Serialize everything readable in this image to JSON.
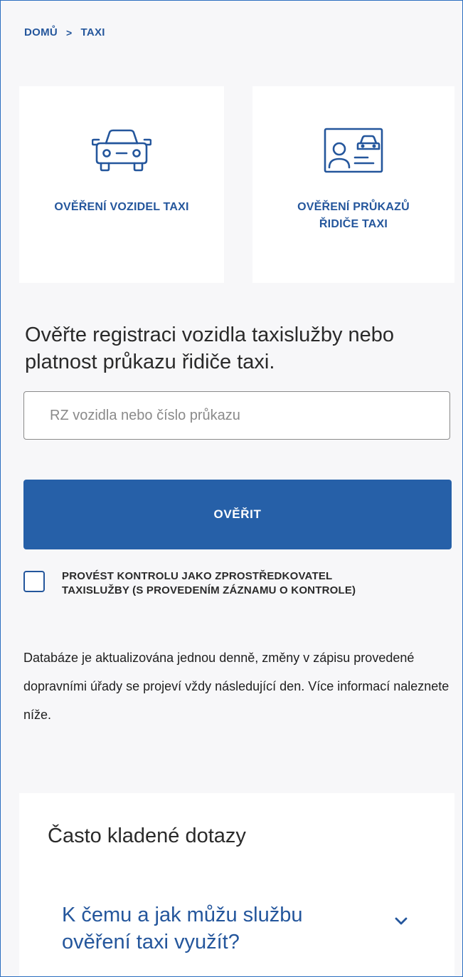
{
  "breadcrumb": {
    "home": "DOMŮ",
    "separator": ">",
    "current": "TAXI"
  },
  "cards": {
    "vehicles": {
      "label": "OVĚŘENÍ VOZIDEL TAXI",
      "icon": "car-icon"
    },
    "licenses": {
      "label_line1": "OVĚŘENÍ PRŮKAZŮ",
      "label_line2": "ŘIDIČE TAXI",
      "icon": "driver-license-icon"
    }
  },
  "main": {
    "heading": "Ověřte registraci vozidla taxislužby nebo platnost průkazu řidiče taxi.",
    "search": {
      "placeholder": "RZ vozidla nebo číslo průkazu",
      "value": ""
    },
    "verify_label": "OVĚŘIT",
    "checkbox": {
      "checked": false,
      "label_line1": "PROVÉST KONTROLU JAKO ZPROSTŘEDKOVATEL",
      "label_line2": "TAXISLUŽBY (S PROVEDENÍM ZÁZNAMU O KONTROLE)"
    },
    "info": "Databáze je aktualizována jednou denně, změny v zápisu provedené dopravními úřady se projeví vždy následující den. Více informací naleznete níže."
  },
  "faq": {
    "title": "Často kladené dotazy",
    "items": [
      {
        "question": "K čemu a jak můžu službu ověření taxi využít?",
        "expanded": false
      }
    ]
  },
  "colors": {
    "primary": "#2660a8",
    "link": "#24569c",
    "background": "#f7f7f9",
    "card": "#ffffff"
  }
}
